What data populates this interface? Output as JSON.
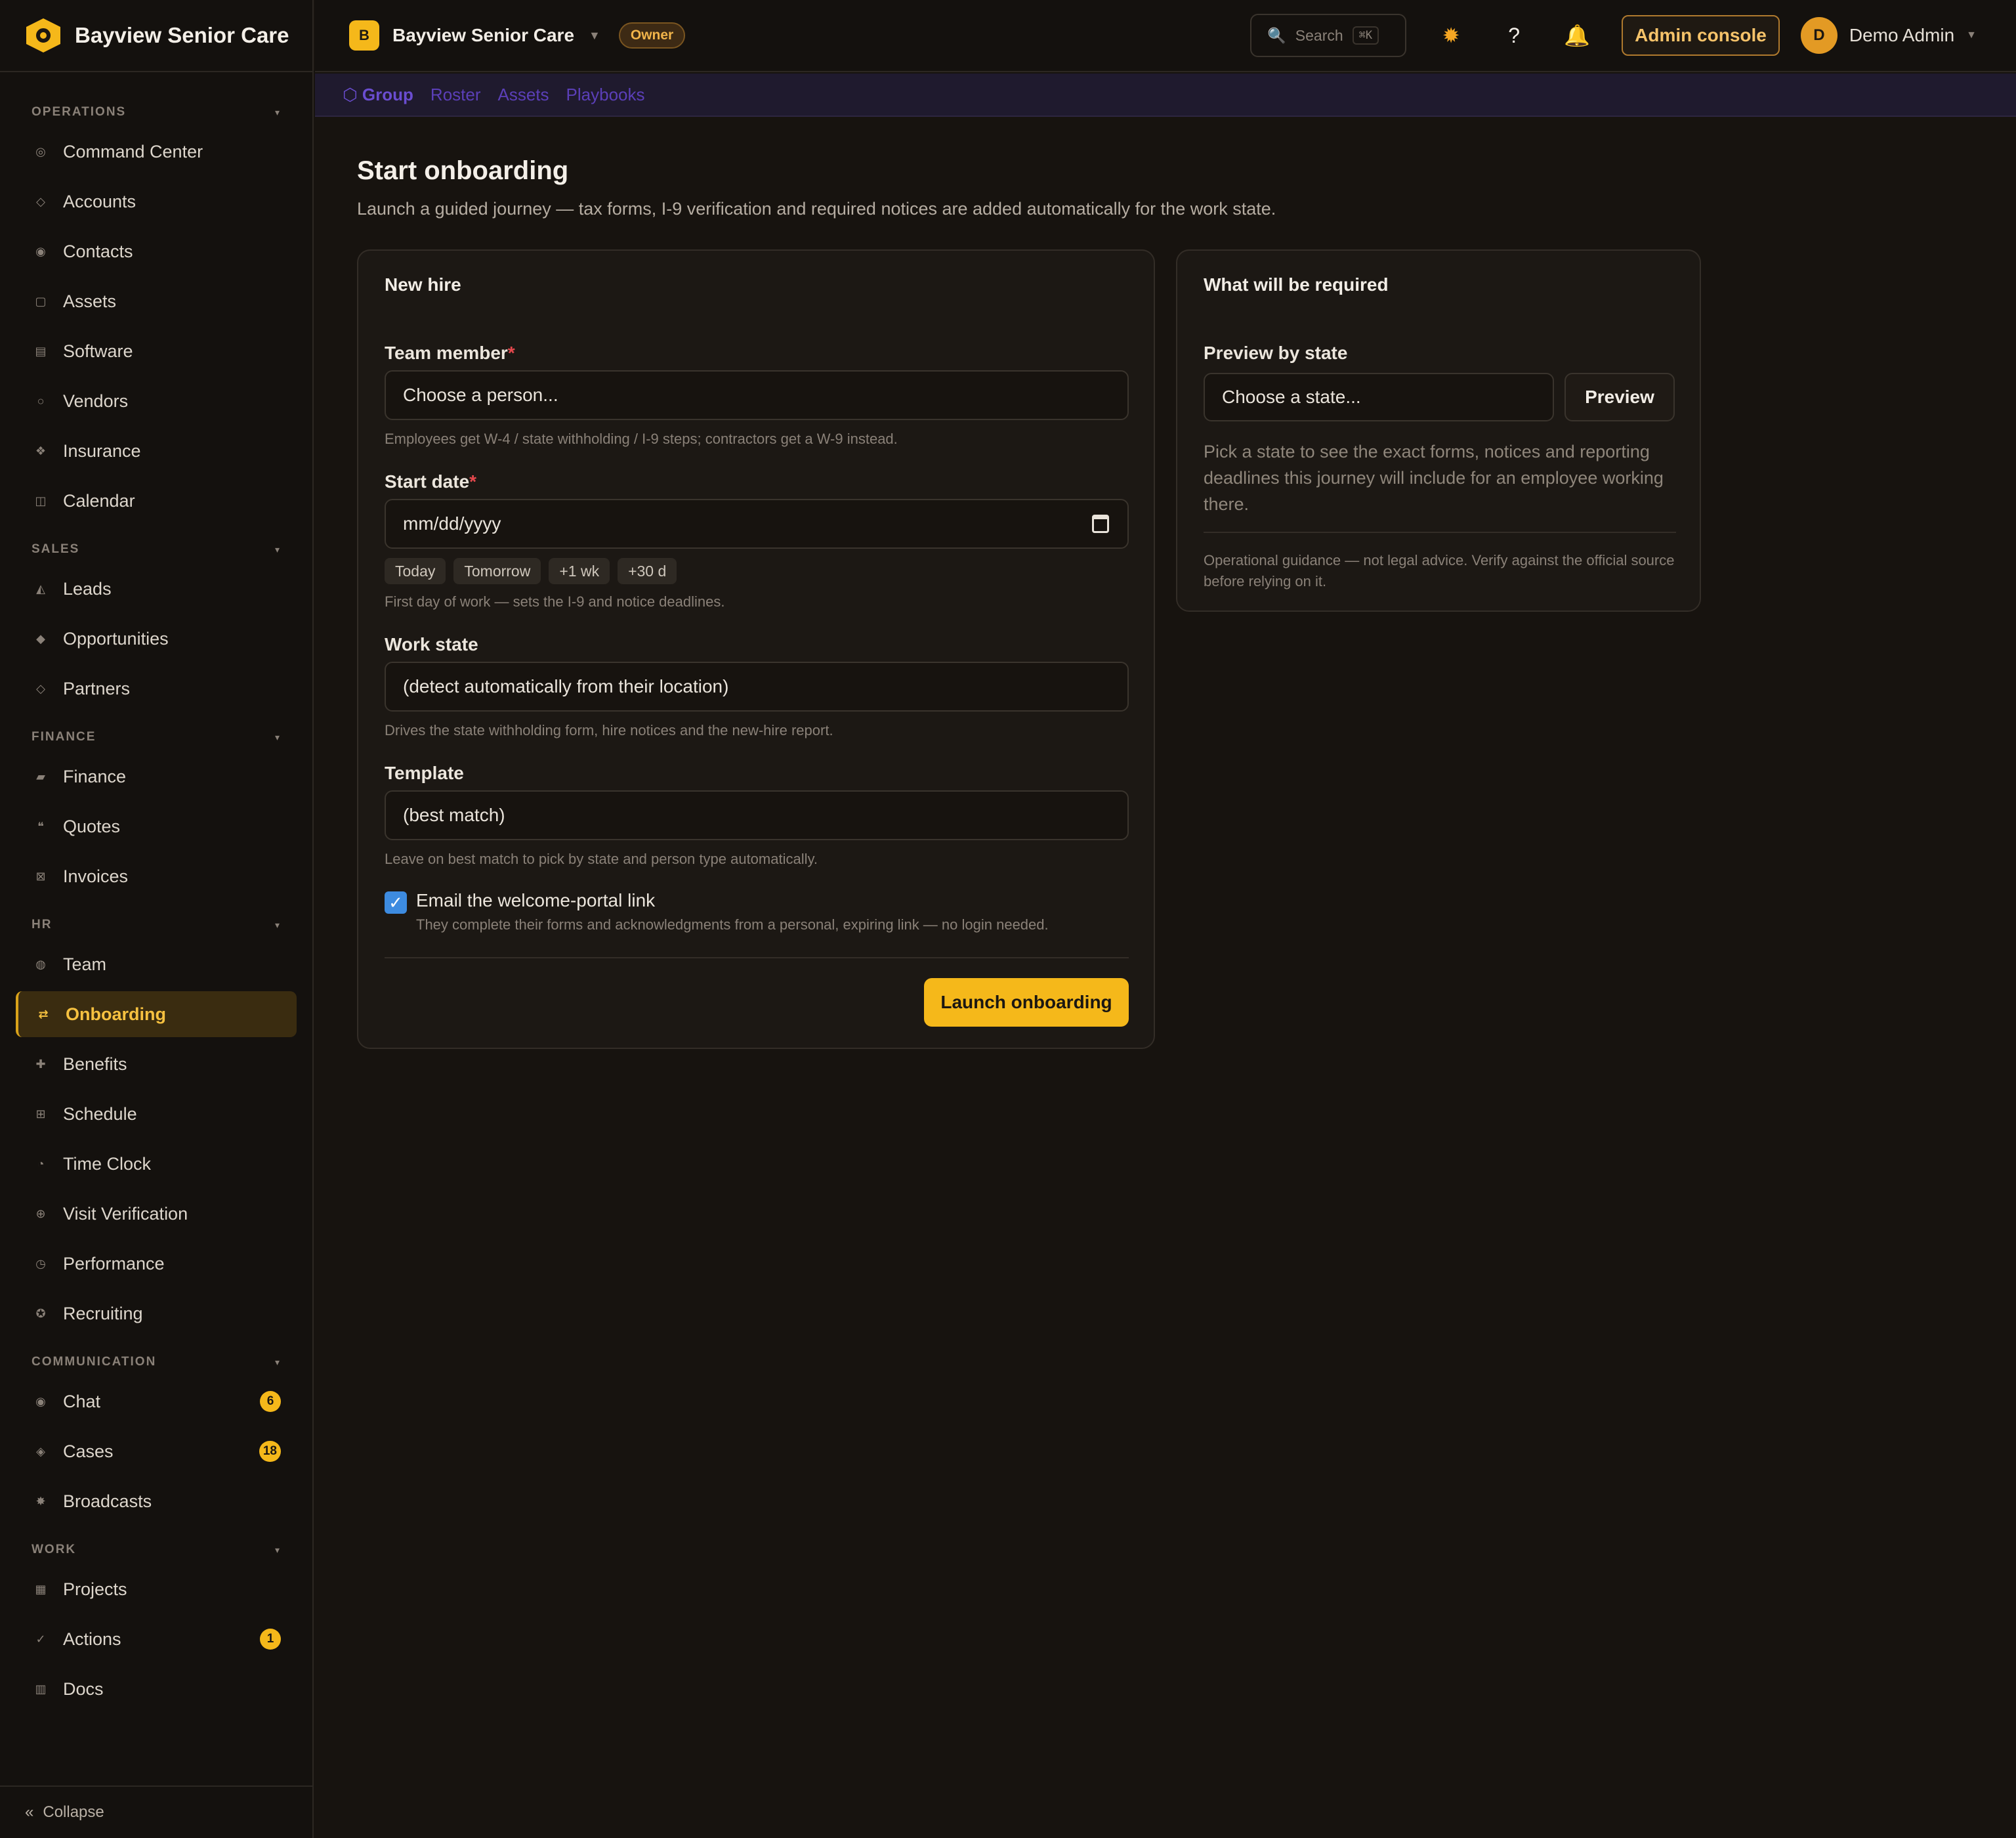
{
  "brand": {
    "name": "Bayview Senior Care"
  },
  "sidebar": {
    "sections": [
      {
        "title": "OPERATIONS",
        "items": [
          {
            "label": "Command Center",
            "icon": "◎"
          },
          {
            "label": "Accounts",
            "icon": "◇"
          },
          {
            "label": "Contacts",
            "icon": "◉"
          },
          {
            "label": "Assets",
            "icon": "▢"
          },
          {
            "label": "Software",
            "icon": "▤"
          },
          {
            "label": "Vendors",
            "icon": "○"
          },
          {
            "label": "Insurance",
            "icon": "❖"
          },
          {
            "label": "Calendar",
            "icon": "◫"
          }
        ]
      },
      {
        "title": "SALES",
        "items": [
          {
            "label": "Leads",
            "icon": "◭"
          },
          {
            "label": "Opportunities",
            "icon": "◆"
          },
          {
            "label": "Partners",
            "icon": "◇"
          }
        ]
      },
      {
        "title": "FINANCE",
        "items": [
          {
            "label": "Finance",
            "icon": "▰"
          },
          {
            "label": "Quotes",
            "icon": "❝"
          },
          {
            "label": "Invoices",
            "icon": "⊠"
          }
        ]
      },
      {
        "title": "HR",
        "items": [
          {
            "label": "Team",
            "icon": "◍"
          },
          {
            "label": "Onboarding",
            "icon": "⇄",
            "active": true
          },
          {
            "label": "Benefits",
            "icon": "✚"
          },
          {
            "label": "Schedule",
            "icon": "⊞"
          },
          {
            "label": "Time Clock",
            "icon": "◔"
          },
          {
            "label": "Visit Verification",
            "icon": "⊕"
          },
          {
            "label": "Performance",
            "icon": "◷"
          },
          {
            "label": "Recruiting",
            "icon": "✪"
          }
        ]
      },
      {
        "title": "COMMUNICATION",
        "items": [
          {
            "label": "Chat",
            "icon": "◉",
            "badge": "6"
          },
          {
            "label": "Cases",
            "icon": "◈",
            "badge": "18"
          },
          {
            "label": "Broadcasts",
            "icon": "✸"
          }
        ]
      },
      {
        "title": "WORK",
        "items": [
          {
            "label": "Projects",
            "icon": "▦"
          },
          {
            "label": "Actions",
            "icon": "✓",
            "badge": "1"
          },
          {
            "label": "Docs",
            "icon": "▥"
          }
        ]
      }
    ],
    "collapse_label": "Collapse"
  },
  "topbar": {
    "org_initial": "B",
    "org_name": "Bayview Senior Care",
    "role": "Owner",
    "search_placeholder": "Search",
    "search_shortcut": "⌘K",
    "admin_label": "Admin console",
    "user_initial": "D",
    "user_name": "Demo Admin"
  },
  "subnav": {
    "items": [
      "⬡ Group",
      "Roster",
      "Assets",
      "Playbooks"
    ]
  },
  "page": {
    "title": "Start onboarding",
    "subtitle": "Launch a guided journey — tax forms, I-9 verification and required notices are added automatically for the work state."
  },
  "new_hire": {
    "title": "New hire",
    "team_member": {
      "label": "Team member",
      "value": "Choose a person...",
      "hint": "Employees get W-4 / state withholding / I-9 steps; contractors get a W-9 instead."
    },
    "start_date": {
      "label": "Start date",
      "value": "mm/dd/yyyy",
      "chips": [
        "Today",
        "Tomorrow",
        "+1 wk",
        "+30 d"
      ],
      "hint": "First day of work — sets the I-9 and notice deadlines."
    },
    "work_state": {
      "label": "Work state",
      "value": "(detect automatically from their location)",
      "hint": "Drives the state withholding form, hire notices and the new-hire report."
    },
    "template": {
      "label": "Template",
      "value": "(best match)",
      "hint": "Leave on best match to pick by state and person type automatically."
    },
    "email_portal": {
      "label": "Email the welcome-portal link",
      "hint": "They complete their forms and acknowledgments from a personal, expiring link — no login needed.",
      "checked": true
    },
    "launch_label": "Launch onboarding"
  },
  "requirements": {
    "title": "What will be required",
    "preview_label": "Preview by state",
    "state_placeholder": "Choose a state...",
    "preview_button": "Preview",
    "body": "Pick a state to see the exact forms, notices and reporting deadlines this journey will include for an employee working there.",
    "disclaimer": "Operational guidance — not legal advice. Verify against the official source before relying on it."
  },
  "colors": {
    "accent": "#f5b81a",
    "active_bg": "#3a2c10",
    "background": "#17130f",
    "subnav_link": "#5b3fb8"
  }
}
